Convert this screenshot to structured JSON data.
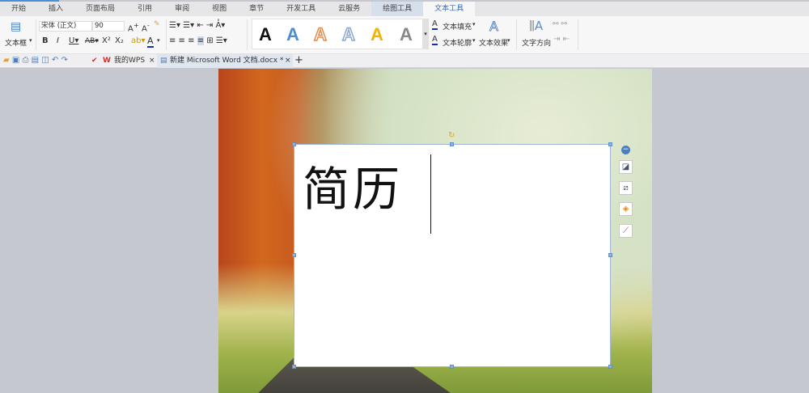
{
  "menu_tabs": [
    "开始",
    "插入",
    "页面布局",
    "引用",
    "审阅",
    "视图",
    "章节",
    "开发工具",
    "云服务",
    "绘图工具",
    "文本工具"
  ],
  "ribbon": {
    "textbox_label": "文本框",
    "font_name": "宋体 (正文)",
    "font_size": "90",
    "text_fill": "文本填充",
    "text_outline": "文本轮廓",
    "text_effect": "文本效果",
    "text_direction": "文字方向",
    "style_colors": [
      "#111111",
      "#4a8fd0",
      "#e88a4a",
      "#8aa8cf",
      "#f2b400",
      "#888888"
    ]
  },
  "doc_tabs": {
    "wps": "我的WPS",
    "doc": "新建 Microsoft Word 文档.docx *",
    "new": "+"
  },
  "document": {
    "text": "简历"
  }
}
